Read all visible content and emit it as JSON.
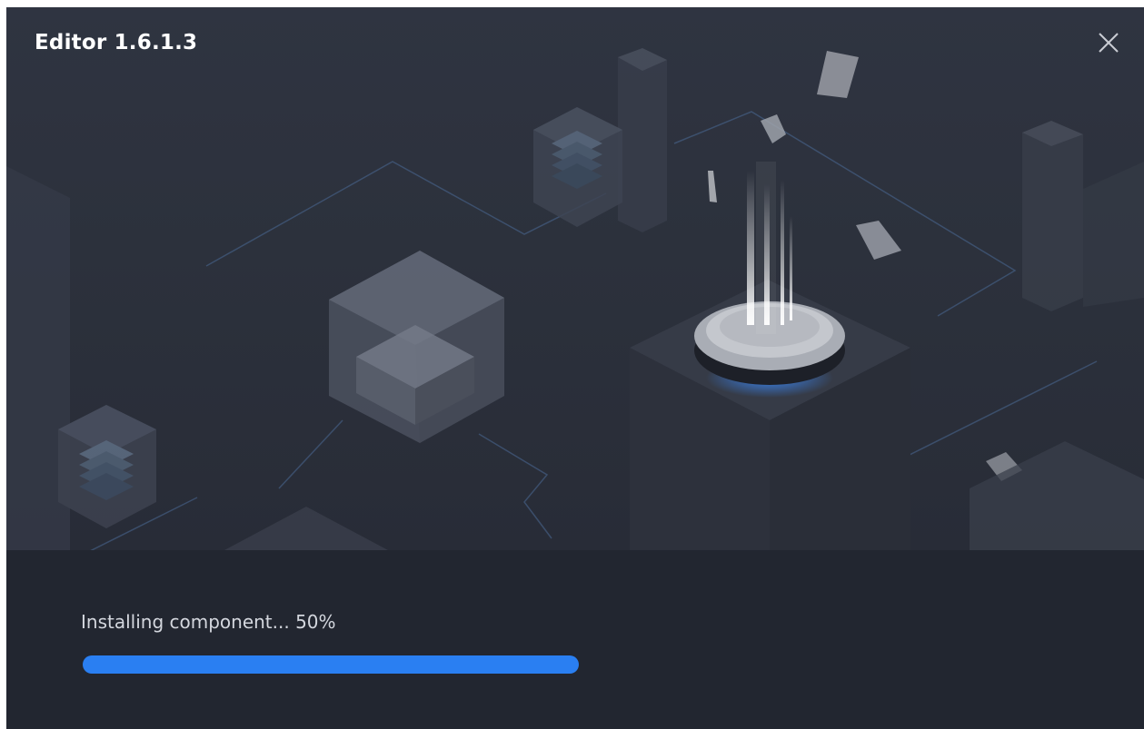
{
  "window": {
    "title": "Editor 1.6.1.3"
  },
  "icons": {
    "close": "close-icon"
  },
  "install": {
    "status_text": "Installing component... 50%",
    "progress": 0.5
  },
  "colors": {
    "accent": "#2a7ff2",
    "background": "#232731",
    "footer": "#222630",
    "title_text": "#ffffff",
    "status_text": "#d4d7de"
  }
}
